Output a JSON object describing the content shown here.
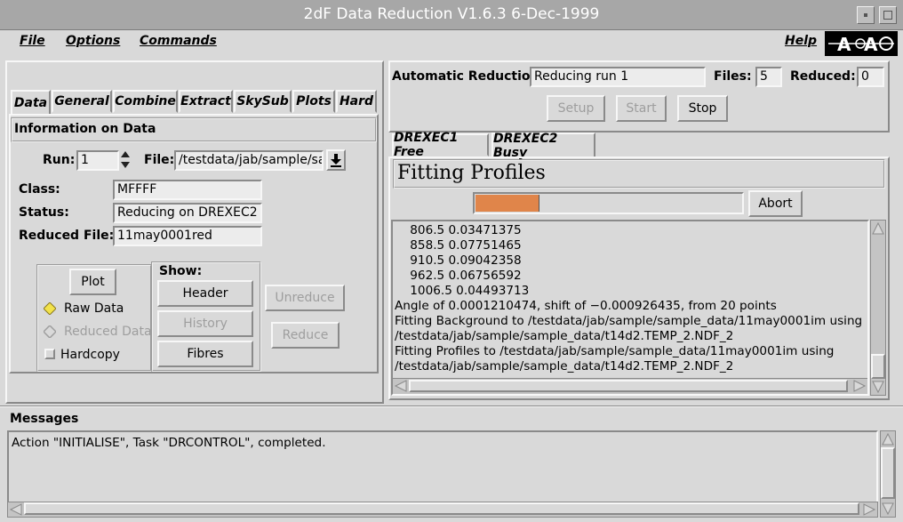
{
  "window": {
    "title": "2dF Data Reduction  V1.6.3  6-Dec-1999"
  },
  "menubar": {
    "file": "File",
    "options": "Options",
    "commands": "Commands",
    "help": "Help"
  },
  "tabs": {
    "data": "Data",
    "general": "General",
    "combine": "Combine",
    "extract": "Extract",
    "skysub": "SkySub",
    "plots": "Plots",
    "hard": "Hard"
  },
  "info": {
    "heading": "Information on Data",
    "run_label": "Run:",
    "run_value": "1",
    "file_label": "File:",
    "file_value": "/testdata/jab/sample/samp",
    "class_label": "Class:",
    "class_value": "MFFFF",
    "status_label": "Status:",
    "status_value": "Reducing on DREXEC2",
    "reduced_label": "Reduced File:",
    "reduced_value": "11may0001red"
  },
  "plotbox": {
    "plot_button": "Plot",
    "raw_data": "Raw Data",
    "reduced_data": "Reduced Data",
    "hardcopy": "Hardcopy",
    "show_label": "Show:",
    "header_button": "Header",
    "history_button": "History",
    "fibres_button": "Fibres",
    "unreduce_button": "Unreduce",
    "reduce_button": "Reduce"
  },
  "auto": {
    "label": "Automatic Reduction:",
    "status_value": "Reducing run 1",
    "files_label": "Files:",
    "files_value": "5",
    "reduced_label": "Reduced:",
    "reduced_value": "0",
    "setup_button": "Setup",
    "start_button": "Start",
    "stop_button": "Stop"
  },
  "exec_tabs": {
    "drexec1": "DREXEC1 Free",
    "drexec2": "DREXEC2 Busy"
  },
  "exec": {
    "task_title": "Fitting Profiles",
    "progress": 0.24,
    "abort_button": "Abort",
    "log_lines": [
      "    806.5 0.03471375",
      "    858.5 0.07751465",
      "    910.5 0.09042358",
      "    962.5 0.06756592",
      "    1006.5 0.04493713",
      "Angle of 0.0001210474, shift of −0.000926435, from 20 points",
      "Fitting Background to /testdata/jab/sample/sample_data/11may0001im using",
      "/testdata/jab/sample/sample_data/t14d2.TEMP_2.NDF_2",
      "Fitting Profiles to /testdata/jab/sample/sample_data/11may0001im using",
      "/testdata/jab/sample/sample_data/t14d2.TEMP_2.NDF_2"
    ]
  },
  "messages": {
    "label": "Messages",
    "text": "Action \"INITIALISE\", Task \"DRCONTROL\", completed."
  },
  "colors": {
    "background": "#d9d9d9",
    "progress_fill": "#e0854a",
    "radio_selected": "#f2e24a",
    "titlebar": "#a7a7a7"
  },
  "icons": {
    "logo": "aao-logo",
    "file_picker": "download-arrow-icon"
  }
}
